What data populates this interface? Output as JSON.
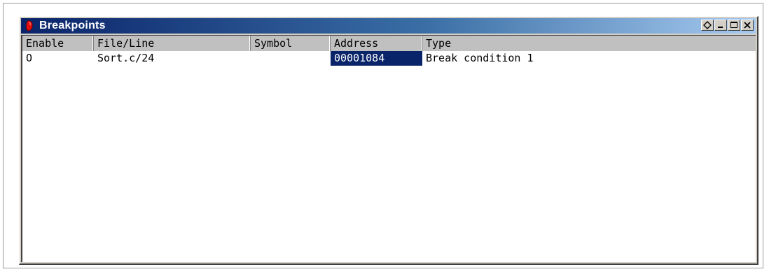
{
  "window": {
    "title": "Breakpoints",
    "icon": "red-breakpoint-icon",
    "title_buttons": [
      "dock-icon",
      "minimize-icon",
      "maximize-icon",
      "close-icon"
    ]
  },
  "table": {
    "columns": [
      "Enable",
      "File/Line",
      "Symbol",
      "Address",
      "Type"
    ],
    "rows": [
      {
        "enable": "O",
        "file_line": "Sort.c/24",
        "symbol": "",
        "address": "00001084",
        "type": "Break condition 1",
        "selected_column": "Address"
      }
    ]
  },
  "colors": {
    "title_start": "#0a246a",
    "title_end": "#a6caf0",
    "selection": "#0a246a",
    "header_bg": "#c0c0c0",
    "window_bg": "#d4d0c8"
  }
}
